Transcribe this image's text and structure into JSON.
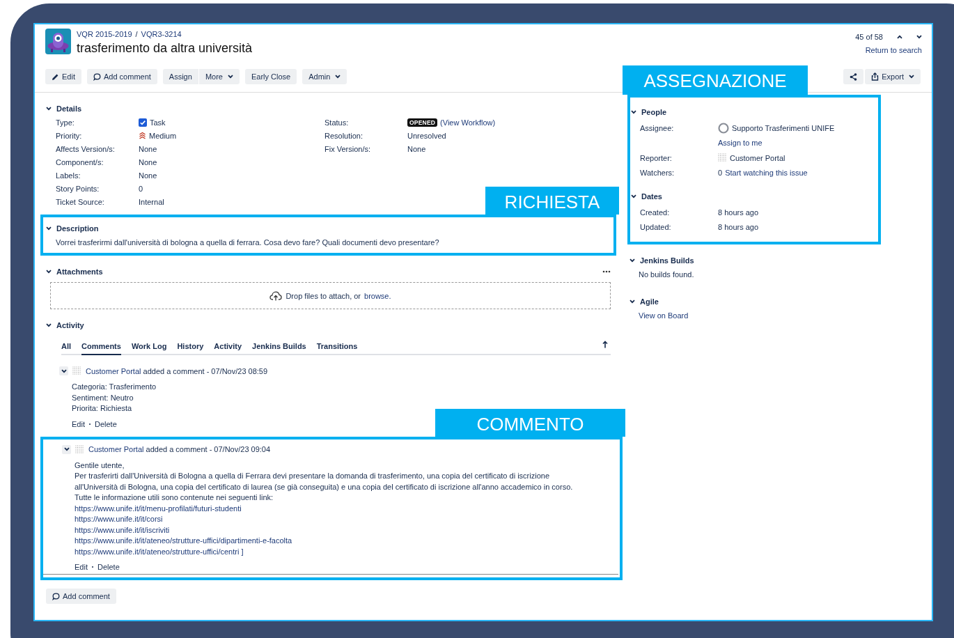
{
  "project": "VQR 2015-2019",
  "separator": "/",
  "issue_key": "VQR3-3214",
  "title": "trasferimento da altra università",
  "pager": {
    "position": "45 of 58",
    "return_link": "Return to search"
  },
  "toolbar": [
    {
      "label": "Edit",
      "kind": "edit"
    },
    {
      "label": "Add comment",
      "kind": "comment"
    },
    {
      "label": "Assign",
      "kind": "grouped"
    },
    {
      "label": "More",
      "kind": "dropdown"
    },
    {
      "label": "Early Close",
      "kind": "plain"
    },
    {
      "label": "Admin",
      "kind": "dropdown"
    }
  ],
  "export_button": "Export",
  "details": {
    "title": "Details",
    "expanded": true,
    "left": [
      {
        "label": "Type:",
        "value": "Task",
        "kind": "type"
      },
      {
        "label": "Priority:",
        "value": "Medium",
        "kind": "priority"
      },
      {
        "label": "Affects Version/s:",
        "value": "None",
        "kind": "text"
      },
      {
        "label": "Component/s:",
        "value": "None",
        "kind": "text"
      },
      {
        "label": "Labels:",
        "value": "None",
        "kind": "text"
      },
      {
        "label": "Story Points:",
        "value": "0",
        "kind": "text"
      },
      {
        "label": "Ticket Source:",
        "value": "Internal",
        "kind": "text"
      }
    ],
    "right": [
      {
        "label": "Status:",
        "value": "OPENED",
        "link": "(View Workflow)",
        "kind": "status"
      },
      {
        "label": "Resolution:",
        "value": "Unresolved",
        "kind": "text"
      },
      {
        "label": "Fix Version/s:",
        "value": "None",
        "kind": "text"
      }
    ]
  },
  "description": {
    "title": "Description",
    "expanded": true,
    "annotation": "RICHIESTA",
    "text": "Vorrei trasferirmi dall'università di bologna a quella di ferrara. Cosa devo fare? Quali documenti devo presentare?"
  },
  "attachments": {
    "title": "Attachments",
    "expanded": true,
    "drop_text": "Drop files to attach, or",
    "browse_link": "browse."
  },
  "activity": {
    "title": "Activity",
    "expanded": true,
    "tabs": [
      {
        "label": "All",
        "selected": false
      },
      {
        "label": "Comments",
        "selected": true
      },
      {
        "label": "Work Log",
        "selected": false
      },
      {
        "label": "History",
        "selected": false
      },
      {
        "label": "Activity",
        "selected": false
      },
      {
        "label": "Jenkins Builds",
        "selected": false
      },
      {
        "label": "Transitions",
        "selected": false
      }
    ],
    "comments": [
      {
        "author": "Customer Portal",
        "action": "added a comment - 07/Nov/23 08:59",
        "expanded": true,
        "body": [
          {
            "kind": "text",
            "text": "Categoria: Trasferimento"
          },
          {
            "kind": "text",
            "text": "Sentiment: Neutro"
          },
          {
            "kind": "text",
            "text": "Priorita: Richiesta"
          }
        ],
        "actions": [
          "Edit",
          "Delete"
        ]
      },
      {
        "author": "Customer Portal",
        "action": "added a comment - 07/Nov/23 09:04",
        "expanded": true,
        "annotation": "COMMENTO",
        "body": [
          {
            "kind": "text",
            "text": "Gentile utente,"
          },
          {
            "kind": "text",
            "text": "Per trasferirti dall'Università di Bologna a quella di Ferrara devi presentare la domanda di trasferimento, una copia del certificato di iscrizione all'Università di Bologna, una copia del certificato di laurea (se già conseguita) e una copia del certificato di iscrizione all'anno accademico in corso."
          },
          {
            "kind": "text",
            "text": "Tutte le informazione utili sono contenute nei seguenti link:"
          },
          {
            "kind": "link",
            "text": "https://www.unife.it/it/menu-profilati/futuri-studenti"
          },
          {
            "kind": "link",
            "text": "https://www.unife.it/it/corsi"
          },
          {
            "kind": "link",
            "text": "https://www.unife.it/it/iscriviti"
          },
          {
            "kind": "link",
            "text": "https://www.unife.it/it/ateneo/strutture-uffici/dipartimenti-e-facolta"
          },
          {
            "kind": "link",
            "text": "https://www.unife.it/it/ateneo/strutture-uffici/centri ]"
          }
        ],
        "actions": [
          "Edit",
          "Delete"
        ]
      }
    ]
  },
  "add_comment_button": "Add comment",
  "sidebar": {
    "annotation": "ASSEGNAZIONE",
    "people": {
      "title": "People",
      "expanded": true,
      "rows": [
        {
          "label": "Assignee:",
          "value": "Supporto Trasferimenti UNIFE",
          "kind": "user"
        },
        {
          "value": "Assign to me",
          "kind": "action"
        },
        {
          "label": "Reporter:",
          "value": "Customer Portal",
          "kind": "portal"
        },
        {
          "label": "Watchers:",
          "count": "0",
          "value": "Start watching this issue",
          "kind": "watchers"
        }
      ]
    },
    "dates": {
      "title": "Dates",
      "expanded": true,
      "rows": [
        {
          "label": "Created:",
          "value": "8 hours ago"
        },
        {
          "label": "Updated:",
          "value": "8 hours ago"
        }
      ]
    },
    "jenkins": {
      "title": "Jenkins Builds",
      "expanded": true,
      "text": "No builds found."
    },
    "agile": {
      "title": "Agile",
      "expanded": true,
      "link": "View on Board"
    }
  }
}
